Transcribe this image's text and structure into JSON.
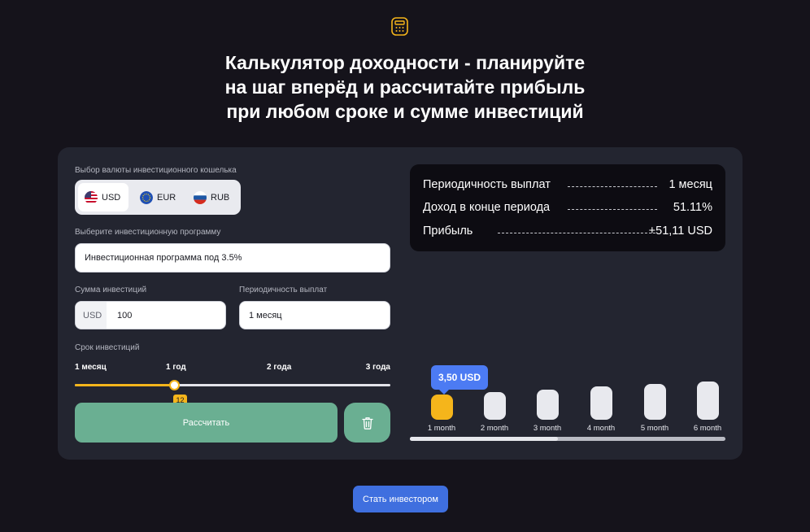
{
  "header": {
    "logo_icon": "calculator-icon",
    "title": "Калькулятор доходности - планируйте\nна шаг вперёд и рассчитайте прибыль\nпри любом сроке и сумме инвестиций"
  },
  "form": {
    "currency_label": "Выбор валюты инвестиционного кошелька",
    "currencies": [
      {
        "code": "USD",
        "icon": "us-flag-icon",
        "selected": true
      },
      {
        "code": "EUR",
        "icon": "eu-flag-icon",
        "selected": false
      },
      {
        "code": "RUB",
        "icon": "ru-flag-icon",
        "selected": false
      }
    ],
    "program_label": "Выберите инвестиционную программу",
    "program_value": "Инвестиционная программа под 3.5%",
    "amount_label": "Сумма инвестиций",
    "amount_prefix": "USD",
    "amount_value": "100",
    "frequency_label": "Периодичность выплат",
    "frequency_value": "1 месяц",
    "term_label": "Срок инвестиций",
    "term_ticks": [
      "1 месяц",
      "1 год",
      "2 года",
      "3 года"
    ],
    "term_value": "12",
    "term_min": 1,
    "term_max": 36,
    "calculate_label": "Рассчитать",
    "delete_icon": "trash-icon"
  },
  "summary": {
    "rows": [
      {
        "key": "Периодичность выплат",
        "value": "1 месяц"
      },
      {
        "key": "Доход в конце периода",
        "value": "51.11%"
      },
      {
        "key": "Прибыль",
        "value": "+51,11 USD"
      }
    ]
  },
  "chart": {
    "tooltip": "3,50 USD",
    "months": [
      {
        "label": "1 month",
        "active": true
      },
      {
        "label": "2 month",
        "active": false
      },
      {
        "label": "3 month",
        "active": false
      },
      {
        "label": "4 month",
        "active": false
      },
      {
        "label": "5 month",
        "active": false
      },
      {
        "label": "6 month",
        "active": false
      }
    ],
    "scroll_fraction": 0.47
  },
  "cta": {
    "label": "Стать инвестором"
  },
  "colors": {
    "accent": "#f5b51b",
    "primary": "#3f6fdf",
    "green": "#6aaf92",
    "background": "#15131b",
    "panel": "#232530"
  }
}
